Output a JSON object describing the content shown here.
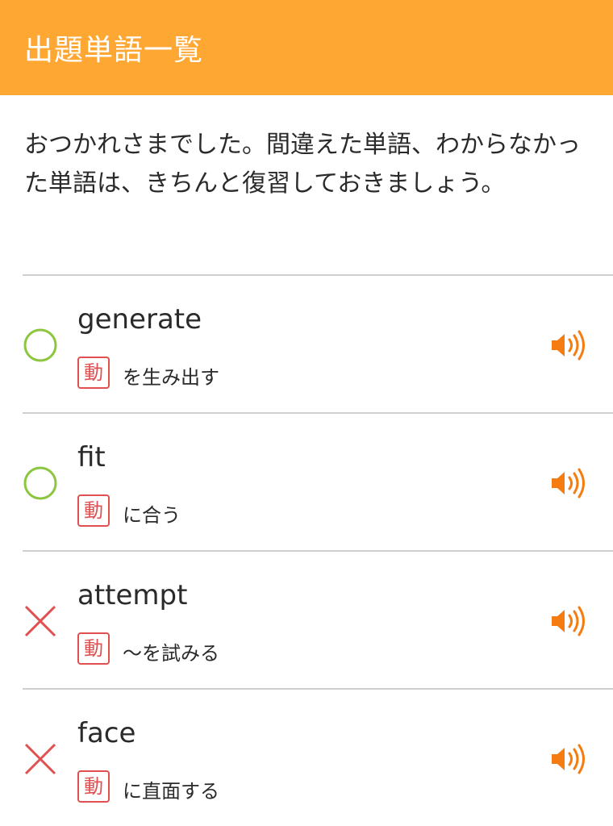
{
  "header": {
    "title": "出題単語一覧"
  },
  "message": "おつかれさまでした。間違えた単語、わからなかった単語は、きちんと復習しておきましょう。",
  "colors": {
    "header_bg": "#ffa733",
    "correct": "#8cc63f",
    "incorrect": "#e05050",
    "speaker": "#f47c10"
  },
  "words": [
    {
      "result_icon": "correct-circle-icon",
      "word": "generate",
      "pos": "動",
      "meaning": "を生み出す"
    },
    {
      "result_icon": "correct-circle-icon",
      "word": "fit",
      "pos": "動",
      "meaning": "に合う"
    },
    {
      "result_icon": "incorrect-cross-icon",
      "word": "attempt",
      "pos": "動",
      "meaning": "～を試みる"
    },
    {
      "result_icon": "incorrect-cross-icon",
      "word": "face",
      "pos": "動",
      "meaning": "に直面する"
    }
  ]
}
